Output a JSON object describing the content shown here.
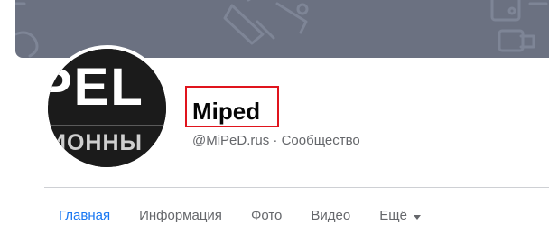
{
  "page": {
    "name": "Miped",
    "handle": "@MiPeD.rus",
    "separator": " · ",
    "category": "Сообщество"
  },
  "tabs": [
    {
      "label": "Главная",
      "active": true
    },
    {
      "label": "Информация",
      "active": false
    },
    {
      "label": "Фото",
      "active": false
    },
    {
      "label": "Видео",
      "active": false
    },
    {
      "label": "Ещё",
      "active": false
    }
  ],
  "avatar": {
    "line1": "PEL",
    "line2": "ИОННЫ"
  },
  "colors": {
    "cover": "#6b7181",
    "highlight_box": "#e0141d",
    "active_tab": "#1877f2",
    "muted_text": "#65676b"
  },
  "icons": [
    "cover-pattern-icon",
    "chevron-down-icon"
  ]
}
